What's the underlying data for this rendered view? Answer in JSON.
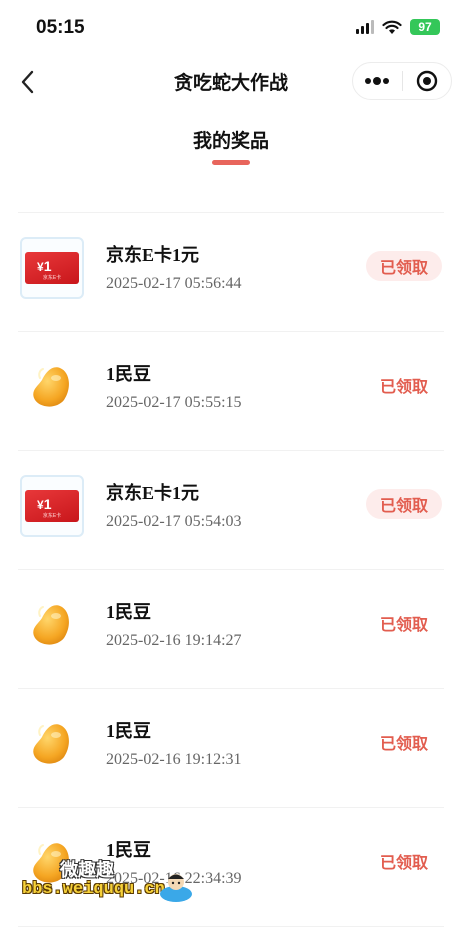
{
  "status_bar": {
    "time": "05:15",
    "battery": "97"
  },
  "nav": {
    "title": "贪吃蛇大作战"
  },
  "section": {
    "title": "我的奖品"
  },
  "prizes": [
    {
      "type": "card",
      "name": "京东E卡1元",
      "time": "2025-02-17 05:56:44",
      "status": "已领取",
      "badge_filled": true
    },
    {
      "type": "bean",
      "name": "1民豆",
      "time": "2025-02-17 05:55:15",
      "status": "已领取",
      "badge_filled": false
    },
    {
      "type": "card",
      "name": "京东E卡1元",
      "time": "2025-02-17 05:54:03",
      "status": "已领取",
      "badge_filled": true
    },
    {
      "type": "bean",
      "name": "1民豆",
      "time": "2025-02-16 19:14:27",
      "status": "已领取",
      "badge_filled": false
    },
    {
      "type": "bean",
      "name": "1民豆",
      "time": "2025-02-16 19:12:31",
      "status": "已领取",
      "badge_filled": false
    },
    {
      "type": "bean",
      "name": "1民豆",
      "time": "2025-02-16 22:34:39",
      "status": "已领取",
      "badge_filled": false
    }
  ],
  "card_art": {
    "amount": "1",
    "currency": "¥",
    "caption": "京东E卡"
  },
  "watermark": {
    "cn": "微趣趣",
    "url": "bbs.weiququ.cn"
  },
  "colors": {
    "accent": "#e8655c",
    "badge_text": "#e25d4f",
    "badge_bg": "#fdeceb"
  }
}
